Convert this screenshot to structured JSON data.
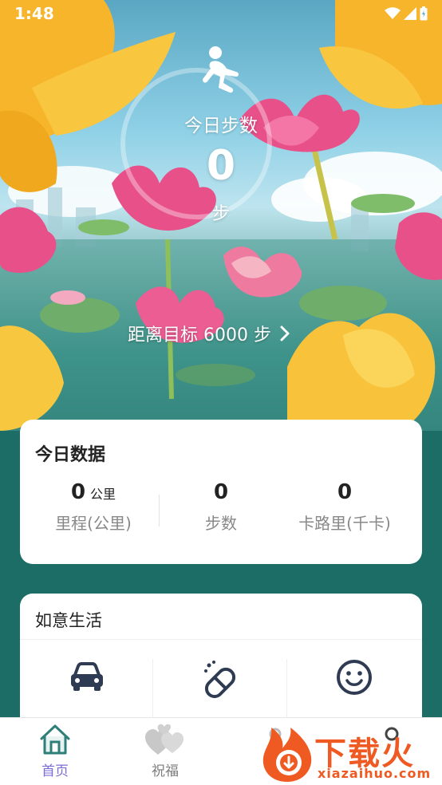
{
  "status_bar": {
    "time": "1:48"
  },
  "hero": {
    "steps_label": "今日步数",
    "steps_value": "0",
    "steps_unit": "步",
    "goal_text": "距离目标 6000 步"
  },
  "today": {
    "title": "今日数据",
    "stats": [
      {
        "value": "0",
        "unit": "公里",
        "label": "里程(公里)"
      },
      {
        "value": "0",
        "unit": "",
        "label": "步数"
      },
      {
        "value": "0",
        "unit": "",
        "label": "卡路里(千卡)"
      }
    ]
  },
  "life": {
    "title": "如意生活",
    "items": [
      {
        "icon": "car-icon"
      },
      {
        "icon": "pill-icon"
      },
      {
        "icon": "smile-icon"
      }
    ]
  },
  "tabs": [
    {
      "label": "首页",
      "icon": "home-icon",
      "active": true
    },
    {
      "label": "祝福",
      "icon": "hearts-icon",
      "active": false
    }
  ],
  "watermark": {
    "brand": "下载火",
    "url": "xiazaihuo.com"
  },
  "colors": {
    "accent": "#7a6cd6",
    "teal": "#1b6d66",
    "icon_dark": "#2e3b52",
    "watermark": "#ef5a22"
  }
}
